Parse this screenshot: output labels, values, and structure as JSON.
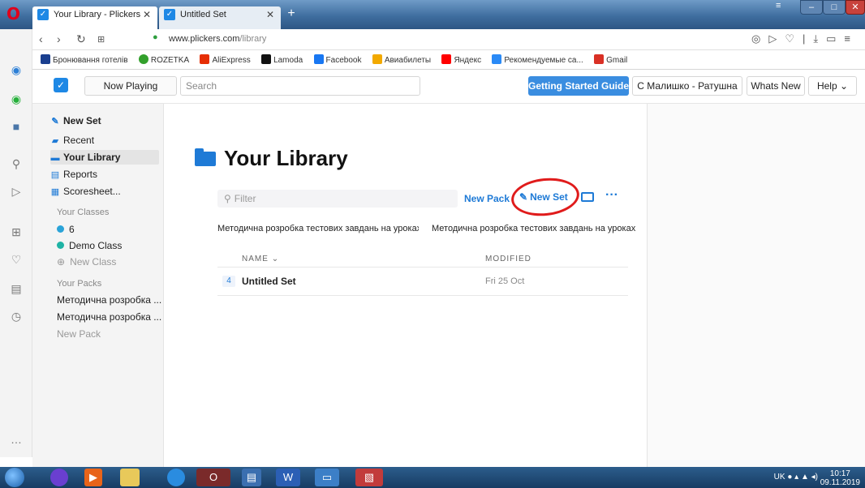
{
  "browser": {
    "tabs": [
      {
        "label": "Your Library - Plickers"
      },
      {
        "label": "Untitled Set"
      }
    ],
    "url_domain": "www.plickers.com",
    "url_path": "/library",
    "bookmarks": [
      {
        "label": "Бронювання готелів",
        "color": "#1a3f8f"
      },
      {
        "label": "ROZETKA",
        "color": "#33a02c"
      },
      {
        "label": "AliExpress",
        "color": "#e62e04"
      },
      {
        "label": "Lamoda",
        "color": "#111111"
      },
      {
        "label": "Facebook",
        "color": "#1877f2"
      },
      {
        "label": "Авиабилеты",
        "color": "#f2a900"
      },
      {
        "label": "Яндекс",
        "color": "#ff0000"
      },
      {
        "label": "Рекомендуемые са...",
        "color": "#2a8af6"
      },
      {
        "label": "Gmail",
        "color": "#d93025"
      }
    ]
  },
  "header": {
    "now_playing": "Now Playing",
    "search_placeholder": "Search",
    "getting_started": "Getting Started Guide",
    "user": "С Малишко - Ратушна",
    "whats_new": "Whats New",
    "help": "Help"
  },
  "sidebar": {
    "new_set": "New Set",
    "recent": "Recent",
    "your_library": "Your Library",
    "reports": "Reports",
    "scoresheet": "Scoresheet...",
    "classes_heading": "Your Classes",
    "classes": [
      {
        "label": "6",
        "color": "#2aa3d8"
      },
      {
        "label": "Demo Class",
        "color": "#1fb3a5"
      }
    ],
    "new_class": "New Class",
    "packs_heading": "Your Packs",
    "packs": [
      "Методична розробка ...",
      "Методична розробка ..."
    ],
    "new_pack": "New Pack"
  },
  "main": {
    "title": "Your Library",
    "filter_placeholder": "Filter",
    "new_pack": "New Pack",
    "new_set": "New Set",
    "more": "···",
    "pack_cards": [
      "Методична розробка тестових завдань на уроках",
      "Методична розробка тестових завдань на уроках"
    ],
    "columns": {
      "name": "NAME",
      "modified": "MODIFIED"
    },
    "rows": [
      {
        "count": "4",
        "name": "Untitled Set",
        "modified": "Fri 25 Oct"
      }
    ]
  },
  "taskbar": {
    "lang": "UK",
    "time": "10:17",
    "date": "09.11.2019"
  }
}
